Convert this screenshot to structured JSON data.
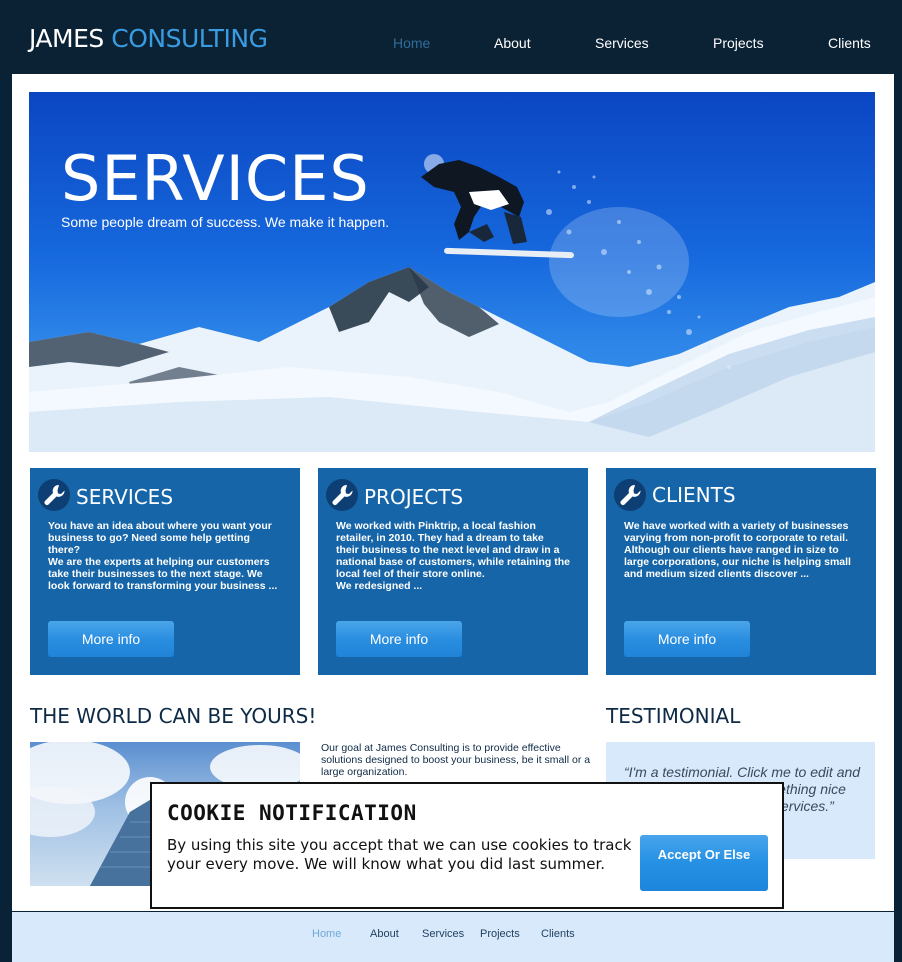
{
  "header": {
    "logo_primary": "JAMES",
    "logo_accent": "CONSULTING",
    "nav": [
      "Home",
      "About",
      "Services",
      "Projects",
      "Clients"
    ],
    "active_nav": "Home"
  },
  "hero": {
    "title": "SERVICES",
    "subtitle": "Some people dream of success. We make it happen."
  },
  "boxes": [
    {
      "icon": "wrench-icon",
      "title": "SERVICES",
      "text": "You have an idea about where you want your\nbusiness to go? Need some help getting there?\nWe are the experts at helping our customers\ntake their businesses to the next stage. We\n look forward to transforming your business ...",
      "button": "More info"
    },
    {
      "icon": "wrench-icon",
      "title": "PROJECTS",
      "text": "We worked with Pinktrip, a local fashion\nretailer, in 2010. They had a dream to take\ntheir business to the next level and draw in a\nnational base of customers, while retaining the\nlocal feel of their store online.\nWe redesigned ...",
      "button": "More info"
    },
    {
      "icon": "wrench-icon",
      "title": "CLIENTS",
      "text": "We have worked with a variety of businesses\nvarying from non-profit to corporate to retail.\nAlthough our clients have ranged in size to\nlarge corporations, our niche is helping small\nand medium sized clients discover  ...",
      "button": "More info"
    }
  ],
  "world": {
    "title": "THE WORLD CAN BE YOURS!",
    "text": "Our goal at James Consulting is to provide effective solutions designed to boost your business, be it small or a large organization."
  },
  "testimonial": {
    "title": "TESTIMONIAL",
    "text": "“I'm a testimonial. Click me to edit and add text that says something nice about you and your services.”"
  },
  "cookie": {
    "title": "COOKIE NOTIFICATION",
    "text": "By using this site you accept that we can use cookies to track your every move. We will know what you did last summer.",
    "button": "Accept Or Else"
  },
  "footer": {
    "nav": [
      "Home",
      "About",
      "Services",
      "Projects",
      "Clients"
    ],
    "active_nav": "Home"
  },
  "colors": {
    "header_bg": "#0b2235",
    "accent": "#3a9be0",
    "box_bg": "#1565a8",
    "button": "#2590e4",
    "testimonial_bg": "#d7e9fb"
  }
}
